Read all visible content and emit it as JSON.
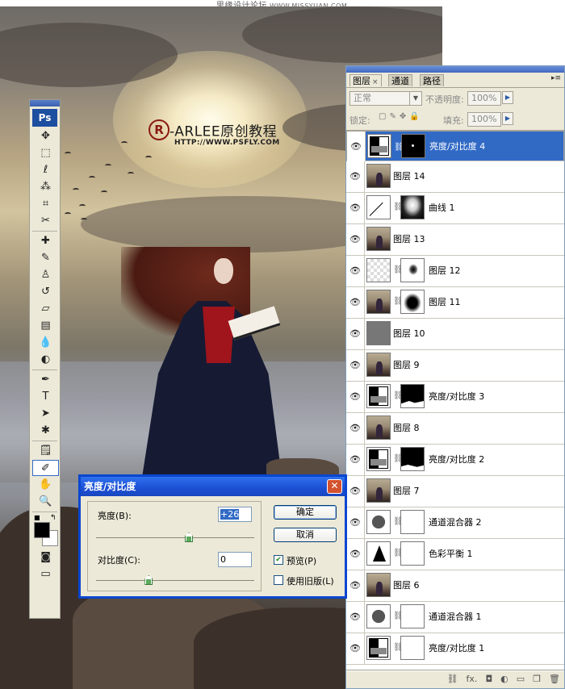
{
  "watermark": {
    "title": "思缘设计论坛",
    "site": "WWW.MISSYUAN.COM"
  },
  "canvas": {
    "logo_mark": "R",
    "logo_text": "-ARLEE原创教程",
    "logo_url": "HTTP://WWW.PSFLY.COM"
  },
  "tools": {
    "ps_label": "Ps",
    "items": [
      {
        "name": "move-tool",
        "glyph": "✥"
      },
      {
        "name": "marquee-tool",
        "glyph": "⬚"
      },
      {
        "name": "lasso-tool",
        "glyph": "ℓ"
      },
      {
        "name": "magic-wand-tool",
        "glyph": "⁂"
      },
      {
        "name": "crop-tool",
        "glyph": "⌗"
      },
      {
        "name": "slice-tool",
        "glyph": "✂"
      },
      {
        "name": "healing-brush-tool",
        "glyph": "✚"
      },
      {
        "name": "brush-tool",
        "glyph": "✎"
      },
      {
        "name": "stamp-tool",
        "glyph": "♙"
      },
      {
        "name": "history-brush-tool",
        "glyph": "↺"
      },
      {
        "name": "eraser-tool",
        "glyph": "▱"
      },
      {
        "name": "gradient-tool",
        "glyph": "▤"
      },
      {
        "name": "blur-tool",
        "glyph": "💧"
      },
      {
        "name": "dodge-tool",
        "glyph": "◐"
      },
      {
        "name": "pen-tool",
        "glyph": "✒"
      },
      {
        "name": "type-tool",
        "glyph": "T"
      },
      {
        "name": "path-selection-tool",
        "glyph": "➤"
      },
      {
        "name": "shape-tool",
        "glyph": "✱"
      },
      {
        "name": "notes-tool",
        "glyph": "🗒"
      },
      {
        "name": "eyedropper-tool",
        "glyph": "✐"
      },
      {
        "name": "hand-tool",
        "glyph": "✋"
      },
      {
        "name": "zoom-tool",
        "glyph": "🔍"
      }
    ]
  },
  "layers_panel": {
    "tabs": [
      {
        "label": "图层"
      },
      {
        "label": "通道"
      },
      {
        "label": "路径"
      }
    ],
    "close_glyph": "×",
    "blend_mode": "正常",
    "opacity_label": "不透明度:",
    "opacity_value": "100%",
    "lock_label": "锁定:",
    "fill_label": "填充:",
    "fill_value": "100%",
    "layers": [
      {
        "name": "亮度/对比度 4",
        "thumb": "adj",
        "mask": "blackdot",
        "selected": true
      },
      {
        "name": "图层 14",
        "thumb": "photo",
        "mask": null,
        "selected": false
      },
      {
        "name": "曲线 1",
        "thumb": "curve",
        "mask": "curve",
        "selected": false
      },
      {
        "name": "图层 13",
        "thumb": "photo",
        "mask": null,
        "selected": false
      },
      {
        "name": "图层 12",
        "thumb": "checker",
        "mask": "soft",
        "selected": false
      },
      {
        "name": "图层 11",
        "thumb": "photo",
        "mask": "blob",
        "selected": false
      },
      {
        "name": "图层 10",
        "thumb": "gray",
        "mask": null,
        "selected": false
      },
      {
        "name": "图层 9",
        "thumb": "photo",
        "mask": null,
        "selected": false
      },
      {
        "name": "亮度/对比度 3",
        "thumb": "adj",
        "mask": "black3",
        "selected": false
      },
      {
        "name": "图层 8",
        "thumb": "photo",
        "mask": null,
        "selected": false
      },
      {
        "name": "亮度/对比度 2",
        "thumb": "adj",
        "mask": "black2",
        "selected": false
      },
      {
        "name": "图层 7",
        "thumb": "photo",
        "mask": null,
        "selected": false
      },
      {
        "name": "通道混合器 2",
        "thumb": "mixer",
        "mask": "white",
        "selected": false
      },
      {
        "name": "色彩平衡 1",
        "thumb": "bal",
        "mask": "white",
        "selected": false
      },
      {
        "name": "图层 6",
        "thumb": "photo",
        "mask": null,
        "selected": false
      },
      {
        "name": "通道混合器 1",
        "thumb": "mixer",
        "mask": "white",
        "selected": false
      },
      {
        "name": "亮度/对比度 1",
        "thumb": "adj",
        "mask": "white",
        "selected": false
      }
    ],
    "bottom_icons": [
      "link-icon",
      "fx-icon",
      "mask-icon",
      "adjustment-icon",
      "group-icon",
      "new-layer-icon",
      "trash-icon"
    ],
    "fx_label": "fx."
  },
  "dialog": {
    "title": "亮度/对比度",
    "close_glyph": "✕",
    "brightness_label": "亮度(B):",
    "brightness_value": "+26",
    "brightness_level": 26,
    "contrast_label": "对比度(C):",
    "contrast_value": "0",
    "contrast_level": 0,
    "ok_label": "确定",
    "cancel_label": "取消",
    "preview_label": "预览(P)",
    "preview_checked": true,
    "legacy_label": "使用旧版(L)",
    "legacy_checked": false
  }
}
